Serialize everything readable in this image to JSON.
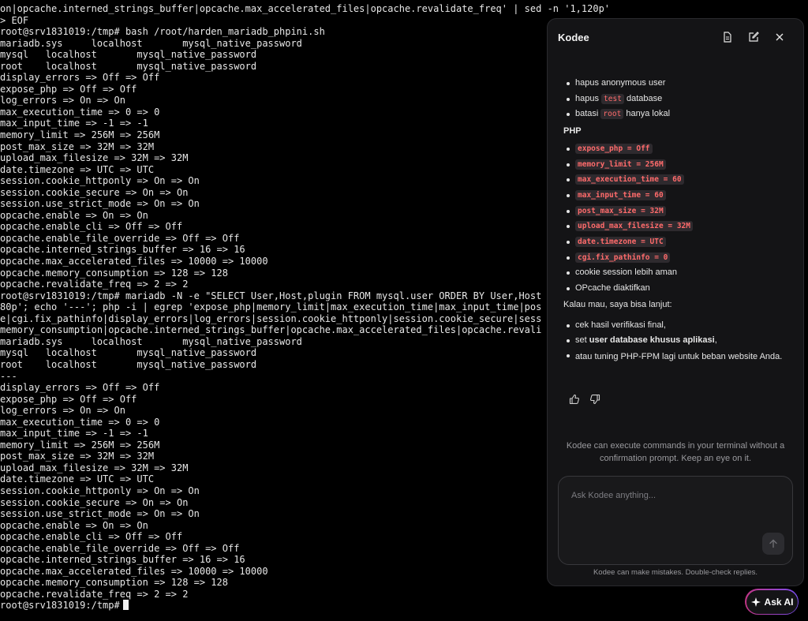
{
  "terminal": {
    "lines": [
      "on|opcache.interned_strings_buffer|opcache.max_accelerated_files|opcache.revalidate_freq' | sed -n '1,120p'",
      "> EOF",
      "root@srv1831019:/tmp# bash /root/harden_mariadb_phpini.sh",
      "mariadb.sys     localhost       mysql_native_password",
      "mysql   localhost       mysql_native_password",
      "root    localhost       mysql_native_password",
      "display_errors => Off => Off",
      "expose_php => Off => Off",
      "log_errors => On => On",
      "max_execution_time => 0 => 0",
      "max_input_time => -1 => -1",
      "memory_limit => 256M => 256M",
      "post_max_size => 32M => 32M",
      "upload_max_filesize => 32M => 32M",
      "date.timezone => UTC => UTC",
      "session.cookie_httponly => On => On",
      "session.cookie_secure => On => On",
      "session.use_strict_mode => On => On",
      "opcache.enable => On => On",
      "opcache.enable_cli => Off => Off",
      "opcache.enable_file_override => Off => Off",
      "opcache.interned_strings_buffer => 16 => 16",
      "opcache.max_accelerated_files => 10000 => 10000",
      "opcache.memory_consumption => 128 => 128",
      "opcache.revalidate_freq => 2 => 2",
      "root@srv1831019:/tmp# mariadb -N -e \"SELECT User,Host,plugin FROM mysql.user ORDER BY User,Host",
      "80p'; echo '---'; php -i | egrep 'expose_php|memory_limit|max_execution_time|max_input_time|pos",
      "e|cgi.fix_pathinfo|display_errors|log_errors|session.cookie_httponly|session.cookie_secure|sess",
      "memory_consumption|opcache.interned_strings_buffer|opcache.max_accelerated_files|opcache.revali",
      "mariadb.sys     localhost       mysql_native_password",
      "mysql   localhost       mysql_native_password",
      "root    localhost       mysql_native_password",
      "---",
      "display_errors => Off => Off",
      "expose_php => Off => Off",
      "log_errors => On => On",
      "max_execution_time => 0 => 0",
      "max_input_time => -1 => -1",
      "memory_limit => 256M => 256M",
      "post_max_size => 32M => 32M",
      "upload_max_filesize => 32M => 32M",
      "date.timezone => UTC => UTC",
      "session.cookie_httponly => On => On",
      "session.cookie_secure => On => On",
      "session.use_strict_mode => On => On",
      "opcache.enable => On => On",
      "opcache.enable_cli => Off => Off",
      "opcache.enable_file_override => Off => Off",
      "opcache.interned_strings_buffer => 16 => 16",
      "opcache.max_accelerated_files => 10000 => 10000",
      "opcache.memory_consumption => 128 => 128",
      "opcache.revalidate_freq => 2 => 2"
    ],
    "prompt": "root@srv1831019:/tmp#"
  },
  "panel": {
    "title": "Kodee",
    "icons": [
      "document-icon",
      "edit-icon",
      "close-icon"
    ],
    "db_items": [
      {
        "pre": "hapus anonymous user",
        "code": "",
        "post": ""
      },
      {
        "pre": "hapus ",
        "code": "test",
        "post": " database"
      },
      {
        "pre": "batasi ",
        "code": "root",
        "post": " hanya lokal"
      }
    ],
    "php_heading": "PHP",
    "php_codes": [
      "expose_php = Off",
      "memory_limit = 256M",
      "max_execution_time = 60",
      "max_input_time = 60",
      "post_max_size = 32M",
      "upload_max_filesize = 32M",
      "date.timezone = UTC",
      "cgi.fix_pathinfo = 0"
    ],
    "extra_items": [
      "cookie session lebih aman",
      "OPcache diaktifkan"
    ],
    "followup": "Kalau mau, saya bisa lanjut:",
    "next_1": "cek hasil verifikasi final,",
    "next_2_pre": "set ",
    "next_2_bold": "user database khusus aplikasi",
    "next_2_post": ",",
    "next_3": "atau tuning PHP-FPM lagi untuk beban website Anda.",
    "warning": "Kodee can execute commands in your terminal without a confirmation prompt. Keep an eye on it.",
    "input_placeholder": "Ask Kodee anything...",
    "disclaimer": "Kodee can make mistakes. Double-check replies."
  },
  "ask_ai": {
    "label": "Ask AI"
  },
  "colors": {
    "code_text": "#ff6b6b",
    "code_bg": "#2e2a2e",
    "panel_bg": "#141416"
  }
}
